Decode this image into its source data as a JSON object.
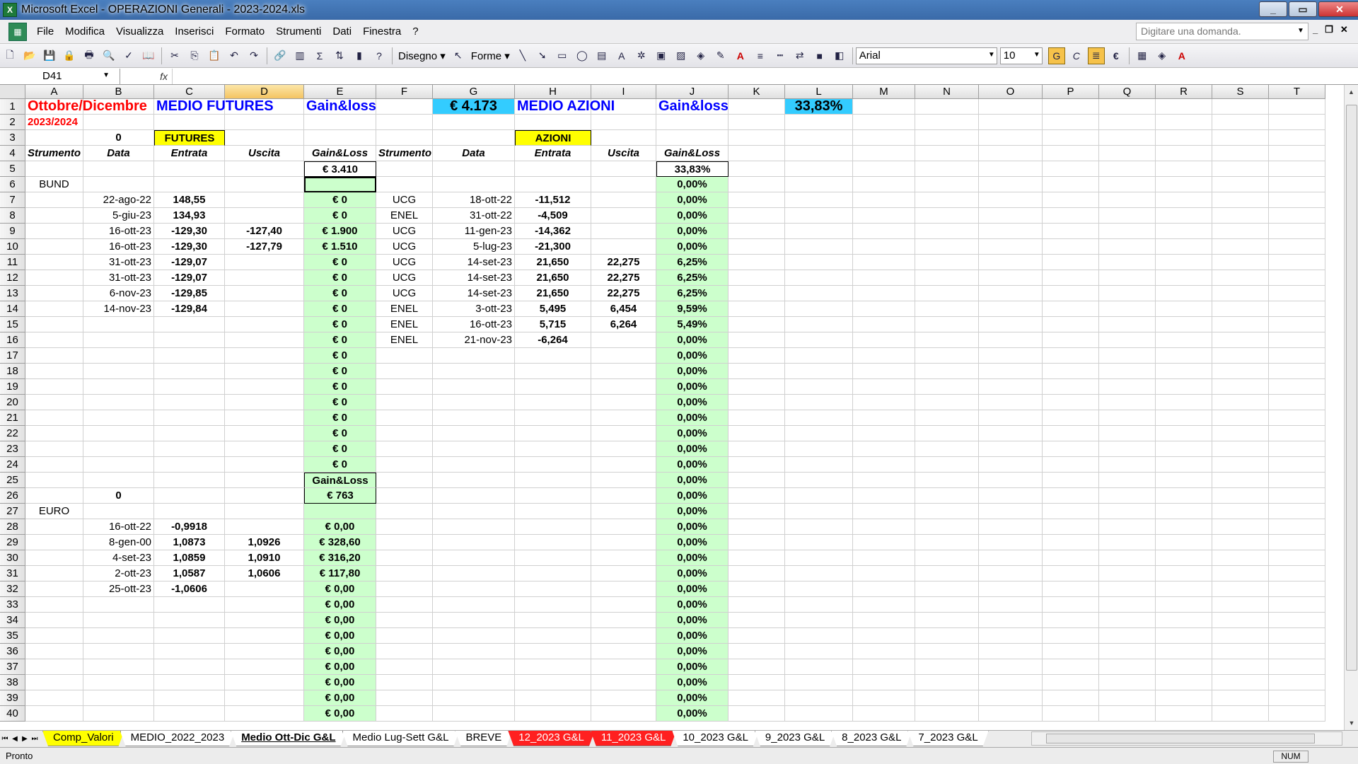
{
  "window": {
    "title": "Microsoft Excel - OPERAZIONI Generali - 2023-2024.xls",
    "app_icon": "excel-icon",
    "controls": [
      "_",
      "▭",
      "✕"
    ]
  },
  "menu": {
    "items": [
      "File",
      "Modifica",
      "Visualizza",
      "Inserisci",
      "Formato",
      "Strumenti",
      "Dati",
      "Finestra",
      "?"
    ],
    "ask_placeholder": "Digitare una domanda.",
    "doc_controls": [
      "_",
      "❐",
      "✕"
    ]
  },
  "toolbar": {
    "disegno": "Disegno ▾",
    "forme": "Forme ▾",
    "font_name": "Arial",
    "font_size": "10",
    "bold": "G",
    "italic": "C",
    "euro": "€"
  },
  "formula_bar": {
    "name_box": "D41",
    "fx": "fx",
    "value": ""
  },
  "columns": [
    "A",
    "B",
    "C",
    "D",
    "E",
    "F",
    "G",
    "H",
    "I",
    "J",
    "K",
    "L",
    "M",
    "N",
    "O",
    "P",
    "Q",
    "R",
    "S",
    "T"
  ],
  "rows": [
    {
      "n": "1",
      "A": "Ottobre/Dicembre",
      "C": "MEDIO FUTURES",
      "E": "Gain&loss",
      "G": "€ 4.173",
      "H": "MEDIO AZIONI",
      "J": "Gain&loss",
      "L": "33,83%"
    },
    {
      "n": "2",
      "A": "2023/2024"
    },
    {
      "n": "3",
      "B": "0",
      "C": "FUTURES",
      "H": "AZIONI"
    },
    {
      "n": "4",
      "A": "Strumento",
      "B": "Data",
      "C": "Entrata",
      "D": "Uscita",
      "E": "Gain&Loss",
      "F": "Strumento",
      "G": "Data",
      "H": "Entrata",
      "I": "Uscita",
      "J": "Gain&Loss"
    },
    {
      "n": "5",
      "E": "€ 3.410",
      "J": "33,83%"
    },
    {
      "n": "6",
      "A": "BUND",
      "J": "0,00%"
    },
    {
      "n": "7",
      "B": "22-ago-22",
      "C": "148,55",
      "E": "€ 0",
      "F": "UCG",
      "G": "18-ott-22",
      "H": "-11,512",
      "J": "0,00%"
    },
    {
      "n": "8",
      "B": "5-giu-23",
      "C": "134,93",
      "E": "€ 0",
      "F": "ENEL",
      "G": "31-ott-22",
      "H": "-4,509",
      "J": "0,00%"
    },
    {
      "n": "9",
      "B": "16-ott-23",
      "C": "-129,30",
      "D": "-127,40",
      "E": "€ 1.900",
      "F": "UCG",
      "G": "11-gen-23",
      "H": "-14,362",
      "J": "0,00%"
    },
    {
      "n": "10",
      "B": "16-ott-23",
      "C": "-129,30",
      "D": "-127,79",
      "E": "€ 1.510",
      "F": "UCG",
      "G": "5-lug-23",
      "H": "-21,300",
      "J": "0,00%"
    },
    {
      "n": "11",
      "B": "31-ott-23",
      "C": "-129,07",
      "E": "€ 0",
      "F": "UCG",
      "G": "14-set-23",
      "H": "21,650",
      "I": "22,275",
      "J": "6,25%"
    },
    {
      "n": "12",
      "B": "31-ott-23",
      "C": "-129,07",
      "E": "€ 0",
      "F": "UCG",
      "G": "14-set-23",
      "H": "21,650",
      "I": "22,275",
      "J": "6,25%"
    },
    {
      "n": "13",
      "B": "6-nov-23",
      "C": "-129,85",
      "E": "€ 0",
      "F": "UCG",
      "G": "14-set-23",
      "H": "21,650",
      "I": "22,275",
      "J": "6,25%"
    },
    {
      "n": "14",
      "B": "14-nov-23",
      "C": "-129,84",
      "E": "€ 0",
      "F": "ENEL",
      "G": "3-ott-23",
      "H": "5,495",
      "I": "6,454",
      "J": "9,59%"
    },
    {
      "n": "15",
      "E": "€ 0",
      "F": "ENEL",
      "G": "16-ott-23",
      "H": "5,715",
      "I": "6,264",
      "J": "5,49%"
    },
    {
      "n": "16",
      "E": "€ 0",
      "F": "ENEL",
      "G": "21-nov-23",
      "H": "-6,264",
      "J": "0,00%"
    },
    {
      "n": "17",
      "E": "€ 0",
      "J": "0,00%"
    },
    {
      "n": "18",
      "E": "€ 0",
      "J": "0,00%"
    },
    {
      "n": "19",
      "E": "€ 0",
      "J": "0,00%"
    },
    {
      "n": "20",
      "E": "€ 0",
      "J": "0,00%"
    },
    {
      "n": "21",
      "E": "€ 0",
      "J": "0,00%"
    },
    {
      "n": "22",
      "E": "€ 0",
      "J": "0,00%"
    },
    {
      "n": "23",
      "E": "€ 0",
      "J": "0,00%"
    },
    {
      "n": "24",
      "E": "€ 0",
      "J": "0,00%"
    },
    {
      "n": "25",
      "E": "Gain&Loss",
      "J": "0,00%"
    },
    {
      "n": "26",
      "B": "0",
      "E": "€ 763",
      "J": "0,00%"
    },
    {
      "n": "27",
      "A": "EURO",
      "J": "0,00%"
    },
    {
      "n": "28",
      "B": "16-ott-22",
      "C": "-0,9918",
      "E": "€ 0,00",
      "J": "0,00%"
    },
    {
      "n": "29",
      "B": "8-gen-00",
      "C": "1,0873",
      "D": "1,0926",
      "E": "€ 328,60",
      "J": "0,00%"
    },
    {
      "n": "30",
      "B": "4-set-23",
      "C": "1,0859",
      "D": "1,0910",
      "E": "€ 316,20",
      "J": "0,00%"
    },
    {
      "n": "31",
      "B": "2-ott-23",
      "C": "1,0587",
      "D": "1,0606",
      "E": "€ 117,80",
      "J": "0,00%"
    },
    {
      "n": "32",
      "B": "25-ott-23",
      "C": "-1,0606",
      "E": "€ 0,00",
      "J": "0,00%"
    },
    {
      "n": "33",
      "E": "€ 0,00",
      "J": "0,00%"
    },
    {
      "n": "34",
      "E": "€ 0,00",
      "J": "0,00%"
    },
    {
      "n": "35",
      "E": "€ 0,00",
      "J": "0,00%"
    },
    {
      "n": "36",
      "E": "€ 0,00",
      "J": "0,00%"
    },
    {
      "n": "37",
      "E": "€ 0,00",
      "J": "0,00%"
    },
    {
      "n": "38",
      "E": "€ 0,00",
      "J": "0,00%"
    },
    {
      "n": "39",
      "E": "€ 0,00",
      "J": "0,00%"
    },
    {
      "n": "40",
      "E": "€ 0,00",
      "J": "0,00%"
    }
  ],
  "tabs": [
    {
      "label": "Comp_Valori",
      "style": "yellow"
    },
    {
      "label": "MEDIO_2022_2023",
      "style": ""
    },
    {
      "label": "Medio Ott-Dic G&L",
      "style": "active"
    },
    {
      "label": "Medio Lug-Sett G&L",
      "style": ""
    },
    {
      "label": "BREVE",
      "style": ""
    },
    {
      "label": "12_2023 G&L",
      "style": "red"
    },
    {
      "label": "11_2023 G&L",
      "style": "red"
    },
    {
      "label": "10_2023 G&L",
      "style": ""
    },
    {
      "label": "9_2023 G&L",
      "style": ""
    },
    {
      "label": "8_2023 G&L",
      "style": ""
    },
    {
      "label": "7_2023 G&L",
      "style": ""
    }
  ],
  "status": {
    "text": "Pronto",
    "num": "NUM"
  },
  "colors": {
    "green_cell": "#ccffcc",
    "yellow_cell": "#ffff00",
    "cyan_cell": "#33ccff",
    "red_text": "#ff0000",
    "blue_text": "#0000ff"
  }
}
